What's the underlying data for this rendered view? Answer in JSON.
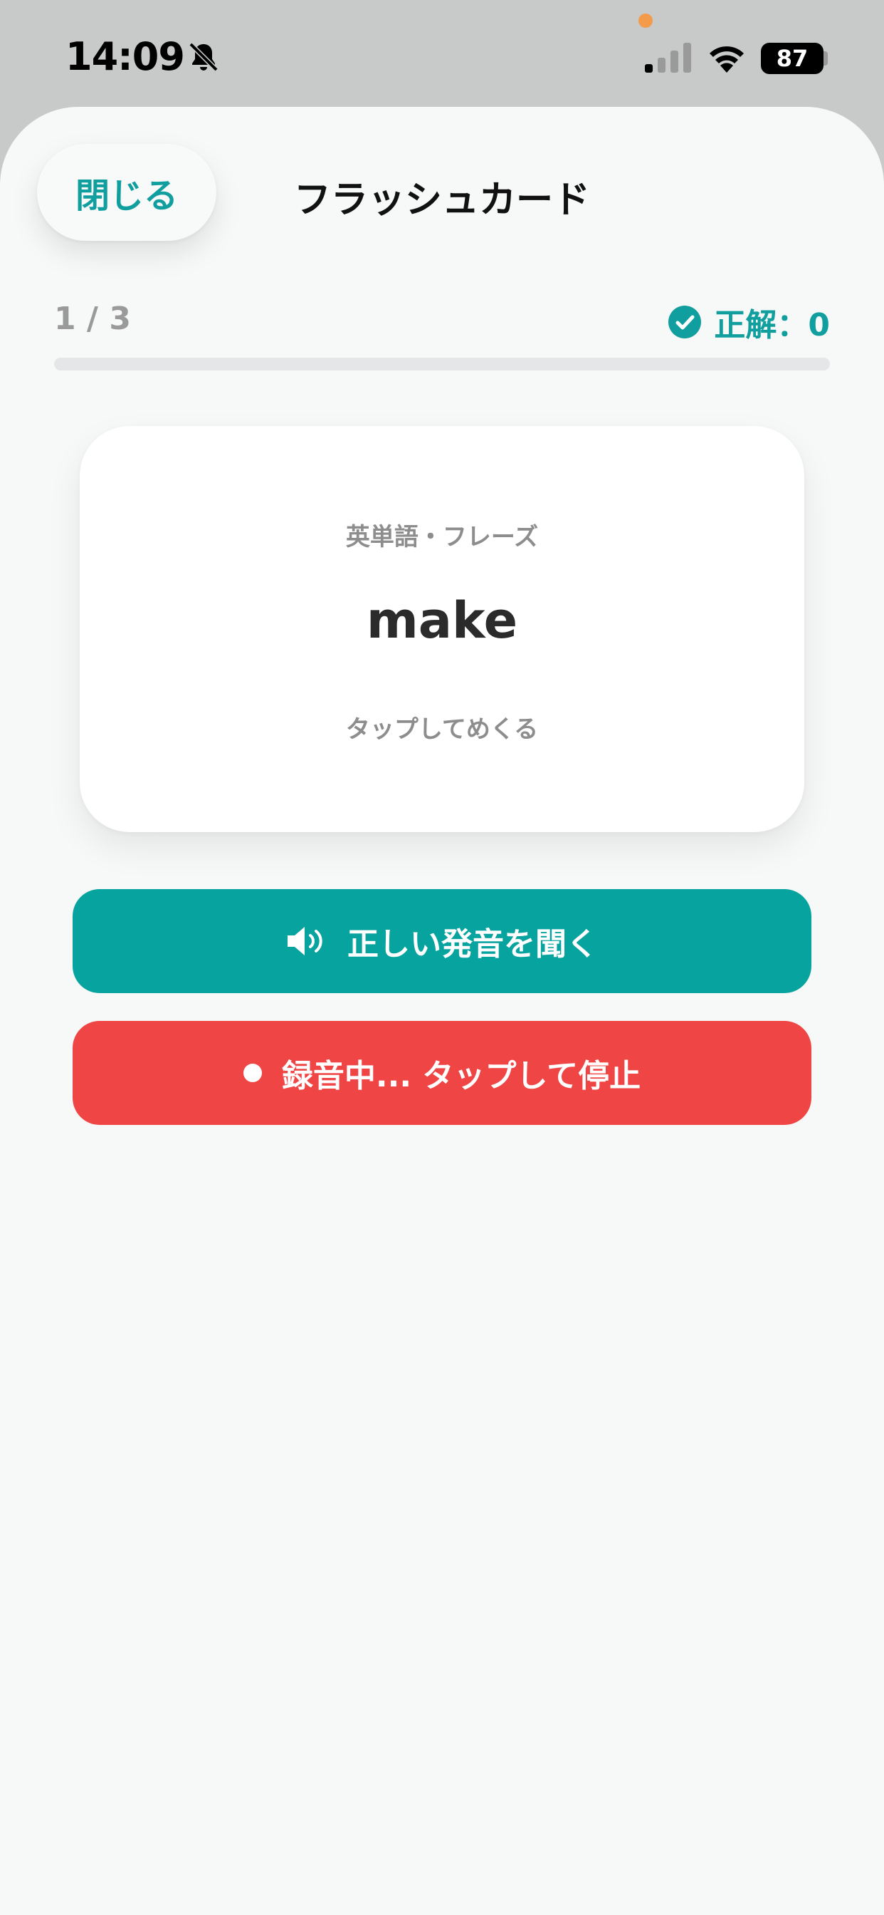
{
  "status_bar": {
    "time": "14:09",
    "battery": "87"
  },
  "header": {
    "close_label": "閉じる",
    "title": "フラッシュカード"
  },
  "progress": {
    "text": "1 / 3",
    "score_label": "正解：0",
    "fraction": 0
  },
  "card": {
    "category": "英単語・フレーズ",
    "word": "make",
    "hint": "タップしてめくる"
  },
  "actions": {
    "listen_label": "正しい発音を聞く",
    "record_label": "録音中... タップして停止"
  },
  "colors": {
    "accent": "#109f9e",
    "listen_button": "#07a39f",
    "record_button": "#f04545"
  }
}
